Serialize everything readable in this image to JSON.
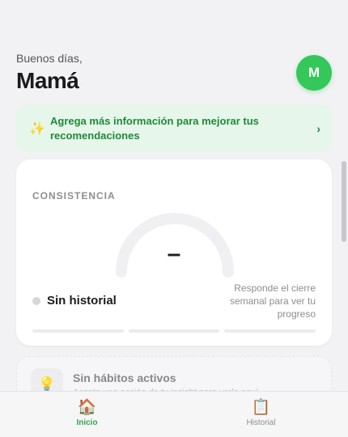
{
  "header": {
    "greeting": "Buenos días,",
    "name": "Mamá",
    "avatar_initial": "M"
  },
  "banner": {
    "text": "Agrega más información para mejorar tus recomendaciones",
    "icon": "sparkles-icon",
    "chevron": "›"
  },
  "consistency": {
    "section_title": "CONSISTENCIA",
    "value": "–",
    "status": "Sin historial",
    "hint": "Responde el cierre semanal para ver tu progreso",
    "progress_segments": 3
  },
  "habits": {
    "title": "Sin hábitos activos",
    "subtitle": "Acepta una acción de tu insight para verla aquí",
    "icon": "lightbulb-icon"
  },
  "tabs": [
    {
      "label": "Inicio",
      "icon": "house-icon",
      "active": true
    },
    {
      "label": "Historial",
      "icon": "clipboard-icon",
      "active": false
    }
  ],
  "colors": {
    "accent": "#34c759",
    "accent_text": "#1e8a3a",
    "banner_bg": "#e7f6ea",
    "background": "#f2f2f4"
  }
}
